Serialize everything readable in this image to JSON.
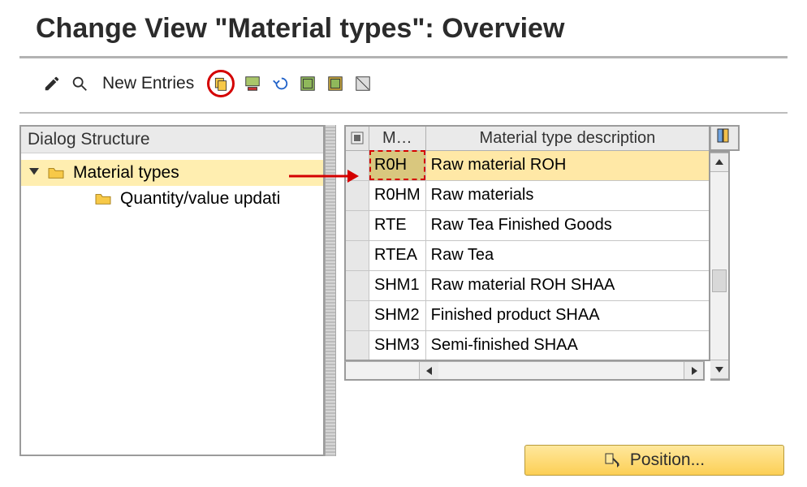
{
  "page_title": "Change View \"Material types\": Overview",
  "toolbar": {
    "new_entries_label": "New Entries"
  },
  "dialog_structure": {
    "header": "Dialog Structure",
    "root": {
      "label": "Material types",
      "child": {
        "label": "Quantity/value updati"
      }
    }
  },
  "table": {
    "col_code_header": "M…",
    "col_desc_header": "Material type description",
    "rows": [
      {
        "code": "R0H",
        "desc": "Raw material ROH",
        "selected": true
      },
      {
        "code": "R0HM",
        "desc": "Raw materials",
        "selected": false
      },
      {
        "code": "RTE",
        "desc": "Raw Tea Finished Goods",
        "selected": false
      },
      {
        "code": "RTEA",
        "desc": "Raw Tea",
        "selected": false
      },
      {
        "code": "SHM1",
        "desc": "Raw material ROH SHAA",
        "selected": false
      },
      {
        "code": "SHM2",
        "desc": "Finished product SHAA",
        "selected": false
      },
      {
        "code": "SHM3",
        "desc": "Semi-finished SHAA",
        "selected": false
      }
    ]
  },
  "position_button_label": "Position...",
  "colors": {
    "highlight_red": "#d40000",
    "selection_yellow": "#ffe8a6"
  }
}
